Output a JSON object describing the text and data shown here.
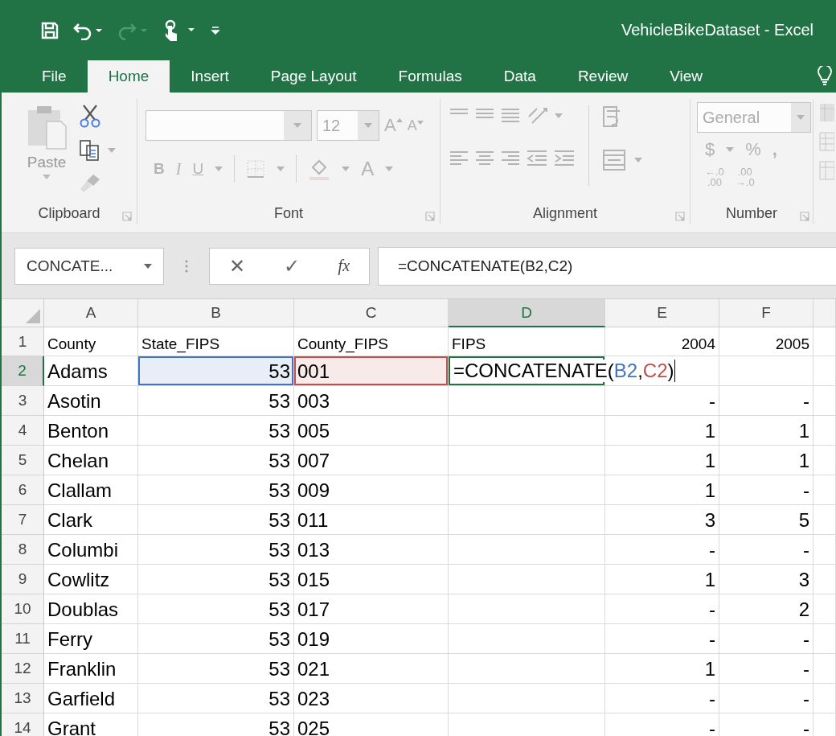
{
  "window": {
    "title": "VehicleBikeDataset - Excel"
  },
  "tabs": [
    {
      "label": "File",
      "selected": false
    },
    {
      "label": "Home",
      "selected": true
    },
    {
      "label": "Insert",
      "selected": false
    },
    {
      "label": "Page Layout",
      "selected": false
    },
    {
      "label": "Formulas",
      "selected": false
    },
    {
      "label": "Data",
      "selected": false
    },
    {
      "label": "Review",
      "selected": false
    },
    {
      "label": "View",
      "selected": false
    }
  ],
  "ribbon": {
    "clipboard": {
      "label": "Clipboard",
      "paste": "Paste"
    },
    "font": {
      "label": "Font",
      "size": "12",
      "grow": "A",
      "shrink": "A",
      "bold": "B",
      "italic": "I",
      "underline": "U",
      "font_color": "A"
    },
    "alignment": {
      "label": "Alignment"
    },
    "number": {
      "label": "Number",
      "format": "General",
      "currency": "$",
      "percent": "%",
      "comma": ",",
      "increase_decimal": [
        "←.0",
        ".00"
      ],
      "decrease_decimal": [
        ".00",
        "→.0"
      ]
    }
  },
  "formula_bar": {
    "name_box": "CONCATE...",
    "cancel": "✕",
    "enter": "✓",
    "insert_function": "fx",
    "formula": "=CONCATENATE(B2,C2)"
  },
  "sheet": {
    "columns": [
      {
        "label": "A",
        "selected": false
      },
      {
        "label": "B",
        "selected": false
      },
      {
        "label": "C",
        "selected": false
      },
      {
        "label": "D",
        "selected": true
      },
      {
        "label": "E",
        "selected": false
      },
      {
        "label": "F",
        "selected": false
      }
    ],
    "rows": [
      {
        "number": "1",
        "selected": false,
        "cells": [
          {
            "kind": "text",
            "text": "County"
          },
          {
            "kind": "text",
            "text": "State_FIPS"
          },
          {
            "kind": "text",
            "text": "County_FIPS"
          },
          {
            "kind": "text",
            "text": "FIPS"
          },
          {
            "kind": "number",
            "text": "2004"
          },
          {
            "kind": "number",
            "text": "2005"
          }
        ]
      },
      {
        "number": "2",
        "selected": true,
        "cells": [
          {
            "kind": "text",
            "text": "Adams"
          },
          {
            "kind": "number",
            "text": "53",
            "color": "#4472c4"
          },
          {
            "kind": "text",
            "text": "001",
            "color": "#c0504d"
          },
          {
            "kind": "formula",
            "active": true,
            "parts": [
              {
                "text": "=CONCATENATE("
              },
              {
                "text": "B2",
                "color": "#4472c4"
              },
              {
                "text": ","
              },
              {
                "text": "C2",
                "color": "#c0504d"
              },
              {
                "text": ")"
              }
            ]
          },
          {
            "kind": "empty"
          },
          {
            "kind": "empty"
          }
        ]
      },
      {
        "number": "3",
        "selected": false,
        "cells": [
          {
            "kind": "text",
            "text": "Asotin"
          },
          {
            "kind": "number",
            "text": "53"
          },
          {
            "kind": "text",
            "text": "003"
          },
          {
            "kind": "empty"
          },
          {
            "kind": "number",
            "text": "-"
          },
          {
            "kind": "number",
            "text": "-"
          }
        ]
      },
      {
        "number": "4",
        "selected": false,
        "cells": [
          {
            "kind": "text",
            "text": "Benton"
          },
          {
            "kind": "number",
            "text": "53"
          },
          {
            "kind": "text",
            "text": "005"
          },
          {
            "kind": "empty"
          },
          {
            "kind": "number",
            "text": "1"
          },
          {
            "kind": "number",
            "text": "1"
          }
        ]
      },
      {
        "number": "5",
        "selected": false,
        "cells": [
          {
            "kind": "text",
            "text": "Chelan"
          },
          {
            "kind": "number",
            "text": "53"
          },
          {
            "kind": "text",
            "text": "007"
          },
          {
            "kind": "empty"
          },
          {
            "kind": "number",
            "text": "1"
          },
          {
            "kind": "number",
            "text": "1"
          }
        ]
      },
      {
        "number": "6",
        "selected": false,
        "cells": [
          {
            "kind": "text",
            "text": "Clallam"
          },
          {
            "kind": "number",
            "text": "53"
          },
          {
            "kind": "text",
            "text": "009"
          },
          {
            "kind": "empty"
          },
          {
            "kind": "number",
            "text": "1"
          },
          {
            "kind": "number",
            "text": "-"
          }
        ]
      },
      {
        "number": "7",
        "selected": false,
        "cells": [
          {
            "kind": "text",
            "text": "Clark"
          },
          {
            "kind": "number",
            "text": "53"
          },
          {
            "kind": "text",
            "text": "011"
          },
          {
            "kind": "empty"
          },
          {
            "kind": "number",
            "text": "3"
          },
          {
            "kind": "number",
            "text": "5"
          }
        ]
      },
      {
        "number": "8",
        "selected": false,
        "cells": [
          {
            "kind": "text",
            "text": "Columbi"
          },
          {
            "kind": "number",
            "text": "53"
          },
          {
            "kind": "text",
            "text": "013"
          },
          {
            "kind": "empty"
          },
          {
            "kind": "number",
            "text": "-"
          },
          {
            "kind": "number",
            "text": "-"
          }
        ]
      },
      {
        "number": "9",
        "selected": false,
        "cells": [
          {
            "kind": "text",
            "text": "Cowlitz"
          },
          {
            "kind": "number",
            "text": "53"
          },
          {
            "kind": "text",
            "text": "015"
          },
          {
            "kind": "empty"
          },
          {
            "kind": "number",
            "text": "1"
          },
          {
            "kind": "number",
            "text": "3"
          }
        ]
      },
      {
        "number": "10",
        "selected": false,
        "cells": [
          {
            "kind": "text",
            "text": "Doublas"
          },
          {
            "kind": "number",
            "text": "53"
          },
          {
            "kind": "text",
            "text": "017"
          },
          {
            "kind": "empty"
          },
          {
            "kind": "number",
            "text": "-"
          },
          {
            "kind": "number",
            "text": "2"
          }
        ]
      },
      {
        "number": "11",
        "selected": false,
        "cells": [
          {
            "kind": "text",
            "text": "Ferry"
          },
          {
            "kind": "number",
            "text": "53"
          },
          {
            "kind": "text",
            "text": "019"
          },
          {
            "kind": "empty"
          },
          {
            "kind": "number",
            "text": "-"
          },
          {
            "kind": "number",
            "text": "-"
          }
        ]
      },
      {
        "number": "12",
        "selected": false,
        "cells": [
          {
            "kind": "text",
            "text": "Franklin"
          },
          {
            "kind": "number",
            "text": "53"
          },
          {
            "kind": "text",
            "text": "021"
          },
          {
            "kind": "empty"
          },
          {
            "kind": "number",
            "text": "1"
          },
          {
            "kind": "number",
            "text": "-"
          }
        ]
      },
      {
        "number": "13",
        "selected": false,
        "cells": [
          {
            "kind": "text",
            "text": "Garfield"
          },
          {
            "kind": "number",
            "text": "53"
          },
          {
            "kind": "text",
            "text": "023"
          },
          {
            "kind": "empty"
          },
          {
            "kind": "number",
            "text": "-"
          },
          {
            "kind": "number",
            "text": "-"
          }
        ]
      },
      {
        "number": "14",
        "selected": false,
        "cells": [
          {
            "kind": "text",
            "text": "Grant"
          },
          {
            "kind": "number",
            "text": "53"
          },
          {
            "kind": "text",
            "text": "025"
          },
          {
            "kind": "empty"
          },
          {
            "kind": "number",
            "text": "-"
          },
          {
            "kind": "number",
            "text": "-"
          }
        ]
      }
    ]
  }
}
